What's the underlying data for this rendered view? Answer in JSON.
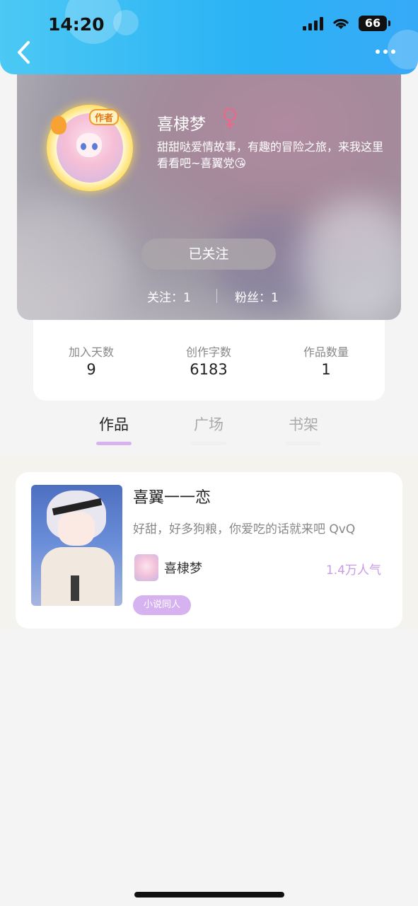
{
  "status_bar": {
    "time": "14:20",
    "battery": "66"
  },
  "profile": {
    "avatar_badge": "作者",
    "username": "喜棣梦",
    "bio": "甜甜哒爱情故事，有趣的冒险之旅，来我这里看看吧~喜翼党😘",
    "follow_button": "已关注",
    "following": "关注：1",
    "fans": "粉丝：1"
  },
  "stats": [
    {
      "label": "加入天数",
      "value": "9"
    },
    {
      "label": "创作字数",
      "value": "6183"
    },
    {
      "label": "作品数量",
      "value": "1"
    }
  ],
  "tabs": [
    {
      "label": "作品",
      "active": true
    },
    {
      "label": "广场",
      "active": false
    },
    {
      "label": "书架",
      "active": false
    }
  ],
  "works": [
    {
      "title": "喜翼一一恋",
      "description": "好甜，好多狗粮，你爱吃的话就来吧 QvQ",
      "author": "喜棣梦",
      "popularity": "1.4万人气",
      "tag": "小说同人"
    }
  ],
  "colors": {
    "header_gradient": [
      "#4cc9f4",
      "#37aaf7"
    ],
    "accent_purple": "#c89be6",
    "tab_active_bar": "#d7b2f0",
    "gender_pink": "#e86a8a"
  }
}
